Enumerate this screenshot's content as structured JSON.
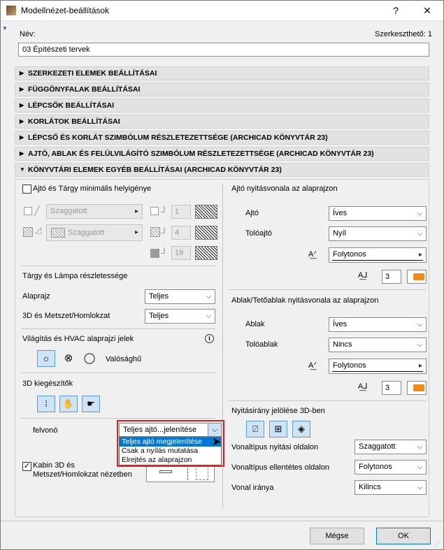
{
  "window": {
    "title": "Modellnézet-beállítások",
    "help": "?",
    "close": "✕"
  },
  "name_label": "Név:",
  "editable_label": "Szerkeszthető: 1",
  "name_value": "03 Építészeti tervek",
  "sections": [
    "SZERKEZETI ELEMEK BEÁLLÍTÁSAI",
    "FÜGGÖNYFALAK BEÁLLÍTÁSAI",
    "LÉPCSŐK BEÁLLÍTÁSAI",
    "KORLÁTOK BEÁLLÍTÁSAI",
    "LÉPCSŐ ÉS KORLÁT SZIMBÓLUM RÉSZLETEZETTSÉGE (ARCHICAD KÖNYVTÁR 23)",
    "AJTÓ, ABLAK ÉS FELÜLVILÁGÍTÓ SZIMBÓLUM RÉSZLETEZETTSÉGE (ARCHICAD KÖNYVTÁR 23)",
    "KÖNYVTÁRI ELEMEK EGYÉB BEÁLLÍTÁSAI (ARCHICAD KÖNYVTÁR 23)"
  ],
  "left": {
    "min_space_label": "Ajtó és Tárgy minimális helyigénye",
    "row1_line": "Szaggatott",
    "row1_pen": "1",
    "row2_line": "Szaggatott",
    "row2_pen": "4",
    "row3_pen": "19",
    "detail_title": "Tárgy és Lámpa részletessége",
    "floorplan_label": "Alaprajz",
    "floorplan_value": "Teljes",
    "section3d_label": "3D és Metszet/Homlokzat",
    "section3d_value": "Teljes",
    "lighting_title": "Világítás és HVAC alaprajzi jelek",
    "lighting_real": "Valósághű",
    "accessories_title": "3D kiegészítők",
    "elevator_label": "felvonó",
    "elevator_value": "Teljes ajtó...jelenítése",
    "elevator_options": [
      "Teljes ajtó megjelenítése",
      "Csak a nyílás mutatása",
      "Elrejtés az alaprajzon"
    ],
    "cabin_label_1": "Kabin 3D és",
    "cabin_label_2": "Metszet/Homlokzat nézetben",
    "cabin_checked": "✓"
  },
  "right": {
    "door_title": "Ajtó nyitásvonala az alaprajzon",
    "door_label": "Ajtó",
    "door_value": "Íves",
    "sliding_label": "Tolóajtó",
    "sliding_value": "Nyíl",
    "door_linetype": "Folytonos",
    "door_pen": "3",
    "window_title": "Ablak/Tetőablak nyitásvonala az alaprajzon",
    "window_label": "Ablak",
    "window_value": "Íves",
    "slidewin_label": "Tolóablak",
    "slidewin_value": "Nincs",
    "window_linetype": "Folytonos",
    "window_pen": "3",
    "dir3d_title": "Nyitásirány jelölése 3D-ben",
    "open_side_label": "Vonaltípus nyitási oldalon",
    "open_side_value": "Szaggatott",
    "opp_side_label": "Vonaltípus ellentétes oldalon",
    "opp_side_value": "Folytonos",
    "line_dir_label": "Vonal iránya",
    "line_dir_value": "Kilincs"
  },
  "buttons": {
    "cancel": "Mégse",
    "ok": "OK"
  },
  "colors": {
    "accent": "#0078d7",
    "highlight_frame": "#e02020",
    "pen_color": "#f28a1a"
  }
}
